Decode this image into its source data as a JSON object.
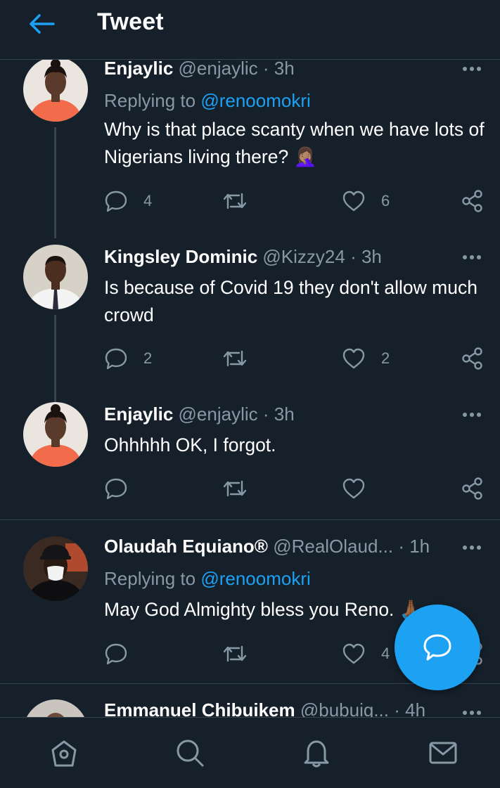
{
  "header": {
    "title": "Tweet"
  },
  "tweets": [
    {
      "name": "Enjaylic",
      "handle": "@enjaylic",
      "time": "· 3h",
      "reply_prefix": "Replying to ",
      "reply_to": "@renoomokri",
      "text": "Why is that place scanty when we have lots of Nigerians living there? 🤦🏽‍♀️",
      "replies": "4",
      "retweets": "",
      "likes": "6"
    },
    {
      "name": "Kingsley Dominic",
      "handle": "@Kizzy24",
      "time": "· 3h",
      "text": "Is because of Covid 19 they don't allow much crowd",
      "replies": "2",
      "retweets": "",
      "likes": "2"
    },
    {
      "name": "Enjaylic",
      "handle": "@enjaylic",
      "time": "· 3h",
      "text": "Ohhhhh OK, I forgot.",
      "replies": "",
      "retweets": "",
      "likes": ""
    },
    {
      "name": "Olaudah Equiano®",
      "handle": "@RealOlaud...",
      "time": "· 1h",
      "reply_prefix": "Replying to ",
      "reply_to": "@renoomokri",
      "text": "May God Almighty bless you Reno. 🙏🏾",
      "replies": "",
      "retweets": "",
      "likes": "4"
    },
    {
      "name": "Emmanuel Chibuikem",
      "handle": "@bubuig...",
      "time": "· 4h"
    }
  ],
  "colors": {
    "background": "#15202b",
    "accent": "#1da1f2",
    "secondary_text": "#8899a6",
    "divider": "#38444d"
  },
  "icons": {
    "back": "arrow-left-icon",
    "more": "more-dots-icon",
    "reply": "speech-bubble-icon",
    "retweet": "retweet-icon",
    "like": "heart-icon",
    "share": "share-icon",
    "compose": "compose-reply-icon",
    "nav": [
      "home-icon",
      "search-icon",
      "bell-icon",
      "mail-icon"
    ]
  }
}
